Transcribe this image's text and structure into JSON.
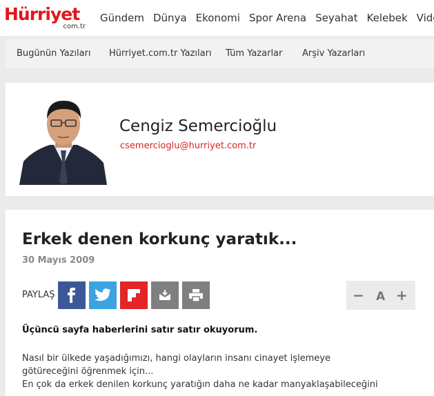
{
  "header": {
    "logo_text": "Hürriyet",
    "logo_sub": "com.tr",
    "nav": [
      "Gündem",
      "Dünya",
      "Ekonomi",
      "Spor Arena",
      "Seyahat",
      "Kelebek",
      "Video"
    ]
  },
  "subnav": [
    "Bugünün Yazıları",
    "Hürriyet.com.tr Yazıları",
    "Tüm Yazarlar",
    "Arşiv Yazarları"
  ],
  "author": {
    "name": "Cengiz Semercioğlu",
    "email": "csemercioglu@hurriyet.com.tr"
  },
  "article": {
    "title": "Erkek denen korkunç yaratık...",
    "date": "30 Mayıs 2009",
    "share_label": "PAYLAŞ",
    "font_controls": {
      "decrease": "−",
      "label": "A",
      "increase": "+"
    },
    "lede": "Üçüncü sayfa haberlerini satır satır okuyorum.",
    "paragraph_lines": [
      "Nasıl bir ülkede yaşadığımızı, hangi olayların insanı cinayet işlemeye",
      "götüreceğini öğrenmek için...",
      "En çok da erkek denilen korkunç yaratığın daha ne kadar manyaklaşabileceğini"
    ]
  },
  "share_buttons": [
    {
      "name": "facebook",
      "icon": "facebook-icon",
      "color": "#3b5998"
    },
    {
      "name": "twitter",
      "icon": "twitter-icon",
      "color": "#3ca2e0"
    },
    {
      "name": "flipboard",
      "icon": "flipboard-icon",
      "color": "#e32428"
    },
    {
      "name": "email",
      "icon": "mail-icon",
      "color": "#7f7f7f"
    },
    {
      "name": "print",
      "icon": "print-icon",
      "color": "#7f7f7f"
    }
  ],
  "colors": {
    "brand": "#e3161b",
    "email": "#dd2222",
    "background": "#ebebeb"
  }
}
